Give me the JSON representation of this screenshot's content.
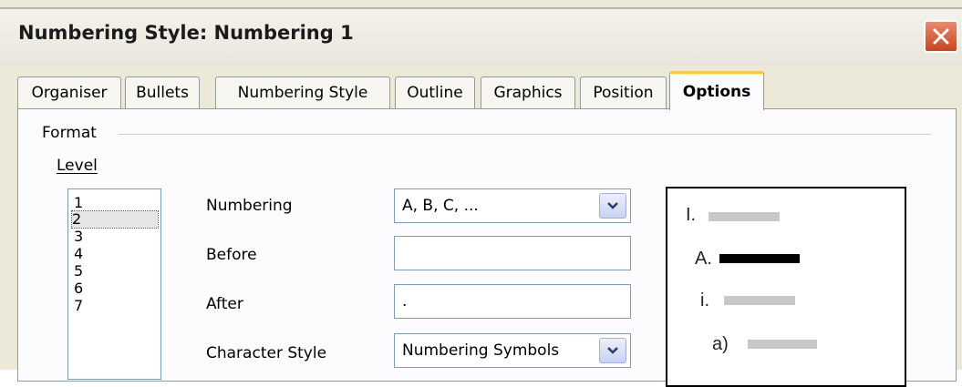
{
  "window": {
    "title": "Numbering Style: Numbering 1",
    "close_icon": "close-icon"
  },
  "tabs": [
    {
      "label": "Organiser"
    },
    {
      "label": "Bullets"
    },
    {
      "label": "Numbering Style"
    },
    {
      "label": "Outline"
    },
    {
      "label": "Graphics"
    },
    {
      "label": "Position"
    },
    {
      "label": "Options",
      "active": true
    }
  ],
  "format": {
    "frame_label": "Format",
    "level_label": "Level",
    "levels": [
      "1",
      "2",
      "3",
      "4",
      "5",
      "6",
      "7"
    ],
    "selected_level": "2"
  },
  "fields": {
    "numbering_label": "Numbering",
    "numbering_value": "A, B, C, ...",
    "before_label": "Before",
    "before_value": "",
    "after_label": "After",
    "after_value": ".",
    "char_style_label": "Character Style",
    "char_style_value": "Numbering Symbols"
  },
  "preview": {
    "lines": [
      {
        "label": "I.",
        "highlight": false
      },
      {
        "label": "A.",
        "highlight": true
      },
      {
        "label": "i.",
        "highlight": false
      },
      {
        "label": "a)",
        "highlight": false
      }
    ],
    "colors": {
      "inactive": "#c8c8c8",
      "active": "#000000"
    }
  }
}
